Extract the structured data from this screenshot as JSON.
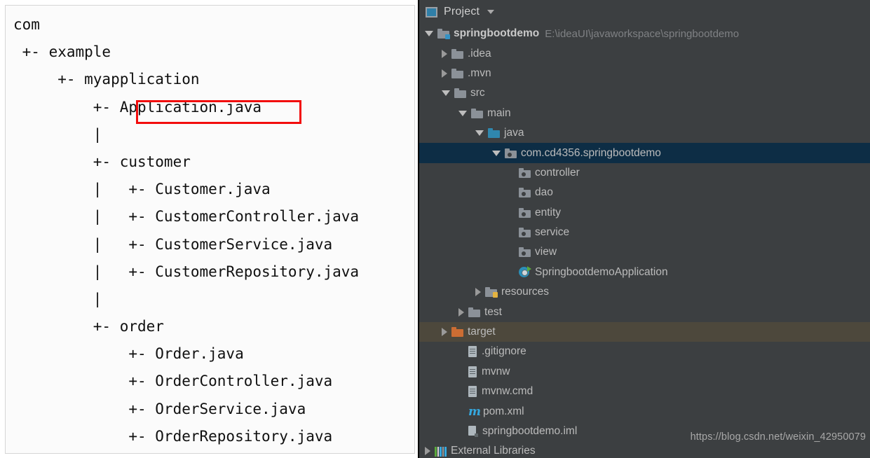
{
  "left_panel": {
    "name": "ascii-package-tree",
    "lines": [
      "com",
      " +- example",
      "     +- myapplication",
      "         +- Application.java",
      "         |",
      "         +- customer",
      "         |   +- Customer.java",
      "         |   +- CustomerController.java",
      "         |   +- CustomerService.java",
      "         |   +- CustomerRepository.java",
      "         |",
      "         +- order",
      "             +- Order.java",
      "             +- OrderController.java",
      "             +- OrderService.java",
      "             +- OrderRepository.java"
    ],
    "highlight": {
      "text": "Application.java",
      "color": "#f20d0d"
    }
  },
  "ide": {
    "toolbar": {
      "window_icon": "project-tool-window-icon",
      "title": "Project",
      "dropdown_icon": "chevron-down-icon"
    },
    "colors": {
      "background": "#3c3f41",
      "selected_row": "#0d2d45",
      "target_row": "#4d483c",
      "text": "#bbbbbb",
      "dim_text": "#7f8184",
      "highlight_box": "#f20d0d",
      "source_root": "#2f87ae",
      "excluded_folder": "#cc6d33"
    },
    "tree": [
      {
        "label": "springbootdemo",
        "secondary": "E:\\ideaUI\\javaworkspace\\springbootdemo",
        "icon": "module-folder-icon",
        "arrow": "down",
        "depth": 0,
        "bold": true,
        "state": "none"
      },
      {
        "label": ".idea",
        "secondary": "",
        "icon": "folder-icon",
        "arrow": "right",
        "depth": 1,
        "bold": false,
        "state": "none"
      },
      {
        "label": ".mvn",
        "secondary": "",
        "icon": "folder-icon",
        "arrow": "right",
        "depth": 1,
        "bold": false,
        "state": "none"
      },
      {
        "label": "src",
        "secondary": "",
        "icon": "folder-icon",
        "arrow": "down",
        "depth": 1,
        "bold": false,
        "state": "none"
      },
      {
        "label": "main",
        "secondary": "",
        "icon": "folder-icon",
        "arrow": "down",
        "depth": 2,
        "bold": false,
        "state": "none"
      },
      {
        "label": "java",
        "secondary": "",
        "icon": "source-root-folder-icon",
        "arrow": "down",
        "depth": 3,
        "bold": false,
        "state": "none"
      },
      {
        "label": "com.cd4356.springbootdemo",
        "secondary": "",
        "icon": "package-icon",
        "arrow": "down",
        "depth": 4,
        "bold": false,
        "state": "selected"
      },
      {
        "label": "controller",
        "secondary": "",
        "icon": "package-icon",
        "arrow": "none",
        "depth": 5,
        "bold": false,
        "state": "none"
      },
      {
        "label": "dao",
        "secondary": "",
        "icon": "package-icon",
        "arrow": "none",
        "depth": 5,
        "bold": false,
        "state": "none"
      },
      {
        "label": "entity",
        "secondary": "",
        "icon": "package-icon",
        "arrow": "none",
        "depth": 5,
        "bold": false,
        "state": "none"
      },
      {
        "label": "service",
        "secondary": "",
        "icon": "package-icon",
        "arrow": "none",
        "depth": 5,
        "bold": false,
        "state": "none"
      },
      {
        "label": "view",
        "secondary": "",
        "icon": "package-icon",
        "arrow": "none",
        "depth": 5,
        "bold": false,
        "state": "none"
      },
      {
        "label": "SpringbootdemoApplication",
        "secondary": "",
        "icon": "spring-boot-run-icon",
        "arrow": "none",
        "depth": 5,
        "bold": false,
        "state": "none"
      },
      {
        "label": "resources",
        "secondary": "",
        "icon": "resources-folder-icon",
        "arrow": "right",
        "depth": 3,
        "bold": false,
        "state": "none"
      },
      {
        "label": "test",
        "secondary": "",
        "icon": "folder-icon",
        "arrow": "right",
        "depth": 2,
        "bold": false,
        "state": "none"
      },
      {
        "label": "target",
        "secondary": "",
        "icon": "excluded-folder-icon",
        "arrow": "right",
        "depth": 1,
        "bold": false,
        "state": "target"
      },
      {
        "label": ".gitignore",
        "secondary": "",
        "icon": "text-file-icon",
        "arrow": "none",
        "depth": 2,
        "bold": false,
        "state": "none"
      },
      {
        "label": "mvnw",
        "secondary": "",
        "icon": "text-file-icon",
        "arrow": "none",
        "depth": 2,
        "bold": false,
        "state": "none"
      },
      {
        "label": "mvnw.cmd",
        "secondary": "",
        "icon": "text-file-icon",
        "arrow": "none",
        "depth": 2,
        "bold": false,
        "state": "none"
      },
      {
        "label": "pom.xml",
        "secondary": "",
        "icon": "maven-pom-icon",
        "arrow": "none",
        "depth": 2,
        "bold": false,
        "state": "none"
      },
      {
        "label": "springbootdemo.iml",
        "secondary": "",
        "icon": "iml-module-file-icon",
        "arrow": "none",
        "depth": 2,
        "bold": false,
        "state": "none"
      },
      {
        "label": "External Libraries",
        "secondary": "",
        "icon": "external-libraries-icon",
        "arrow": "right",
        "depth": 0,
        "bold": false,
        "state": "none"
      }
    ],
    "highlight": {
      "text": "SpringbootdemoApplication",
      "color": "#f20d0d"
    }
  },
  "watermark": {
    "text": "https://blog.csdn.net/weixin_42950079"
  }
}
